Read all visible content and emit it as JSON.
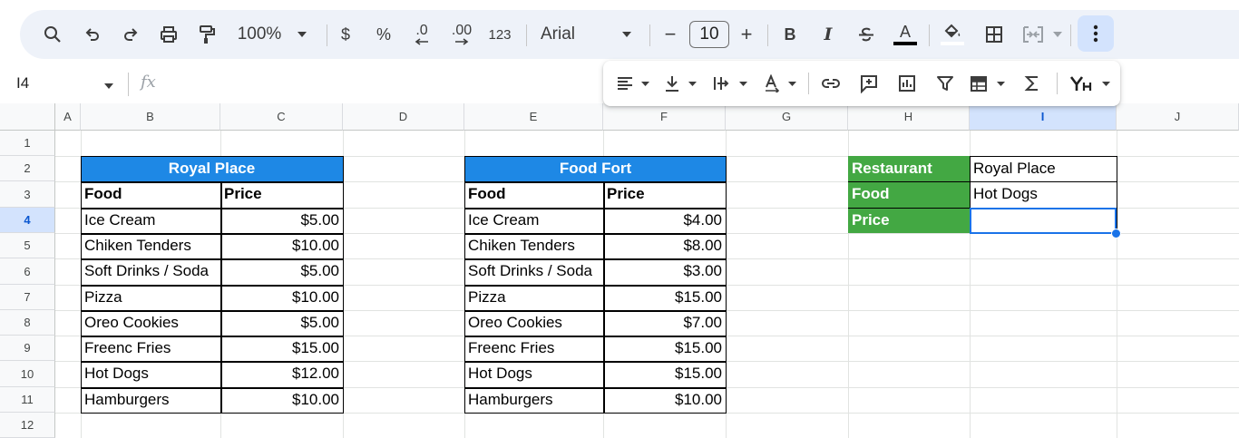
{
  "toolbar": {
    "zoom": "100%",
    "currency": "$",
    "percent": "%",
    "decrease_decimal": ".0",
    "increase_decimal": ".00",
    "number_format": "123",
    "font": "Arial",
    "font_size": "10",
    "minus": "−",
    "plus": "+",
    "bold": "B",
    "italic": "I",
    "text_color": "A"
  },
  "formula_bar": {
    "cell_ref": "I4",
    "fx": "fx"
  },
  "columns": [
    "A",
    "B",
    "C",
    "D",
    "E",
    "F",
    "G",
    "H",
    "I",
    "J"
  ],
  "selected_column": "I",
  "rows": [
    "1",
    "2",
    "3",
    "4",
    "5",
    "6",
    "7",
    "8",
    "9",
    "10",
    "11",
    "12"
  ],
  "selected_row": "4",
  "royal_place": {
    "title": "Royal Place",
    "headers": [
      "Food",
      "Price"
    ],
    "items": [
      [
        "Ice Cream",
        "$5.00"
      ],
      [
        "Chiken Tenders",
        "$10.00"
      ],
      [
        "Soft Drinks / Soda",
        "$5.00"
      ],
      [
        "Pizza",
        "$10.00"
      ],
      [
        "Oreo Cookies",
        "$5.00"
      ],
      [
        "Freenc Fries",
        "$15.00"
      ],
      [
        "Hot Dogs",
        "$12.00"
      ],
      [
        "Hamburgers",
        "$10.00"
      ]
    ]
  },
  "food_fort": {
    "title": "Food Fort",
    "headers": [
      "Food",
      "Price"
    ],
    "items": [
      [
        "Ice Cream",
        "$4.00"
      ],
      [
        "Chiken Tenders",
        "$8.00"
      ],
      [
        "Soft Drinks / Soda",
        "$3.00"
      ],
      [
        "Pizza",
        "$15.00"
      ],
      [
        "Oreo Cookies",
        "$7.00"
      ],
      [
        "Freenc Fries",
        "$15.00"
      ],
      [
        "Hot Dogs",
        "$15.00"
      ],
      [
        "Hamburgers",
        "$10.00"
      ]
    ]
  },
  "lookup": {
    "labels": [
      "Restaurant",
      "Food",
      "Price"
    ],
    "values": [
      "Royal Place",
      "Hot Dogs",
      ""
    ]
  },
  "colors": {
    "header_blue": "#1e88e5",
    "label_green": "#43a843",
    "selection": "#1a73e8",
    "toolbar_bg": "#eef2f9"
  }
}
